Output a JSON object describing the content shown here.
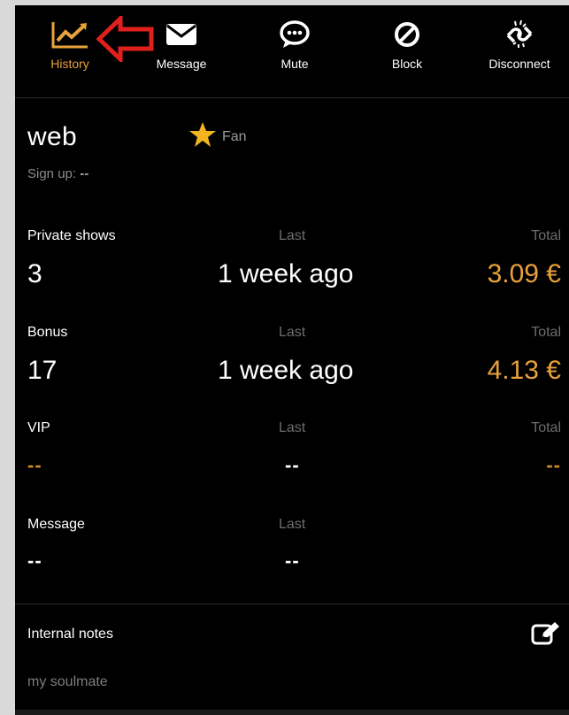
{
  "toolbar": {
    "items": [
      {
        "label": "History",
        "icon": "chart-line-icon",
        "active": true
      },
      {
        "label": "Message",
        "icon": "envelope-icon",
        "active": false
      },
      {
        "label": "Mute",
        "icon": "speech-bubble-icon",
        "active": false
      },
      {
        "label": "Block",
        "icon": "ban-icon",
        "active": false
      },
      {
        "label": "Disconnect",
        "icon": "broken-link-icon",
        "active": false
      }
    ],
    "annotation_arrow": "red-arrow-icon"
  },
  "profile": {
    "name": "web",
    "badge": "Fan",
    "signup_label": "Sign up:",
    "signup_value": "--"
  },
  "stats": {
    "private_shows": {
      "label": "Private shows",
      "last_label": "Last",
      "total_label": "Total",
      "count": "3",
      "last": "1 week ago",
      "total": "3.09 €"
    },
    "bonus": {
      "label": "Bonus",
      "last_label": "Last",
      "total_label": "Total",
      "count": "17",
      "last": "1 week ago",
      "total": "4.13 €"
    },
    "vip": {
      "label": "VIP",
      "last_label": "Last",
      "total_label": "Total",
      "count": "--",
      "last": "--",
      "total": "--"
    },
    "message": {
      "label": "Message",
      "last_label": "Last",
      "count": "--",
      "last": "--"
    }
  },
  "notes": {
    "title": "Internal notes",
    "text": "my soulmate"
  },
  "colors": {
    "accent": "#e8a23a",
    "background": "#000000",
    "annotation": "#e0201c"
  }
}
